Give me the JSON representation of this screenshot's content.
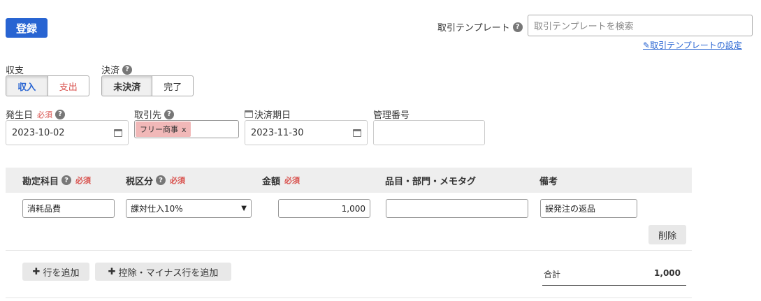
{
  "toolbar": {
    "register_label": "登録"
  },
  "template": {
    "label": "取引テンプレート",
    "search_placeholder": "取引テンプレートを検索",
    "settings_link": "取引テンプレートの設定"
  },
  "income_expense": {
    "label": "収支",
    "options": [
      "収入",
      "支出"
    ],
    "selected": "収入"
  },
  "settlement": {
    "label": "決済",
    "options": [
      "未決済",
      "完了"
    ],
    "selected": "未決済"
  },
  "issue_date": {
    "label": "発生日",
    "required": "必須",
    "value": "2023-10-02"
  },
  "partner": {
    "label": "取引先",
    "tag": "フリー商事",
    "tag_remove": "x"
  },
  "due_date": {
    "label": "決済期日",
    "value": "2023-11-30"
  },
  "management_no": {
    "label": "管理番号",
    "value": ""
  },
  "table": {
    "headers": {
      "account": "勘定科目",
      "tax": "税区分",
      "amount": "金額",
      "tags": "品目・部門・メモタグ",
      "memo": "備考",
      "required": "必須"
    },
    "row": {
      "account": "消耗品費",
      "tax": "課対仕入10%",
      "amount": "1,000",
      "tags": "",
      "memo": "誤発注の返品",
      "delete_label": "削除"
    }
  },
  "footer": {
    "add_row": "行を追加",
    "add_deduction_row": "控除・マイナス行を追加",
    "total_label": "合計",
    "total_value": "1,000"
  },
  "colors": {
    "accent": "#2864d2",
    "required": "#d9534f",
    "expense": "#d9534f"
  }
}
